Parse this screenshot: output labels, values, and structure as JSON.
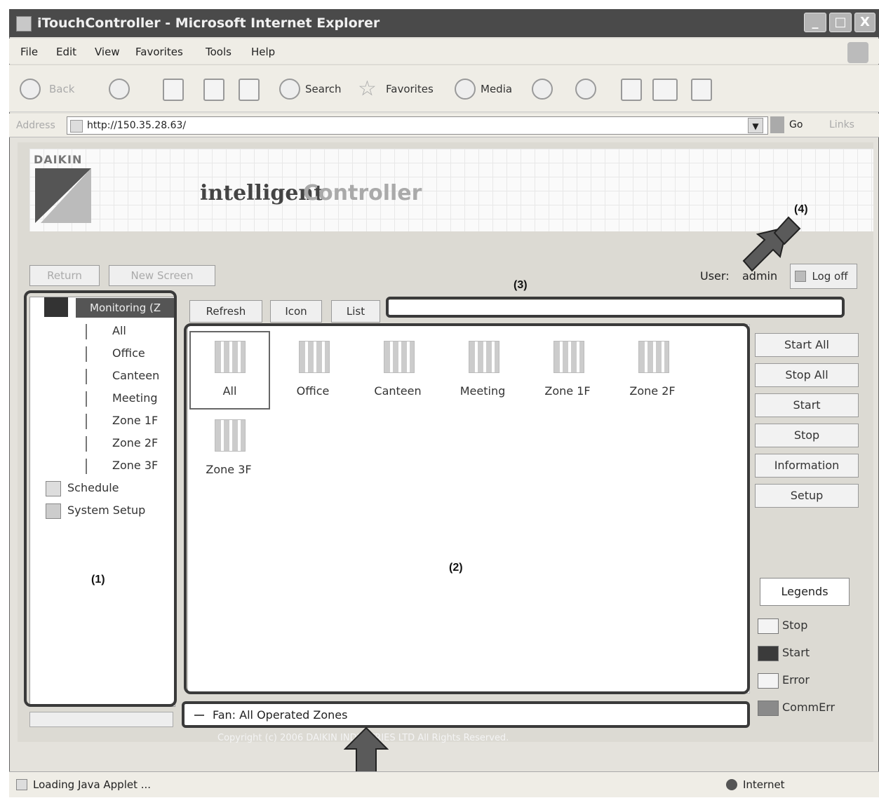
{
  "window": {
    "title": "iTouchController - Microsoft Internet Explorer",
    "min": "_",
    "max": "□",
    "close": "X"
  },
  "menu": [
    "File",
    "Edit",
    "View",
    "Favorites",
    "Tools",
    "Help"
  ],
  "toolbar": {
    "back": "Back",
    "search": "Search",
    "favorites": "Favorites",
    "media": "Media"
  },
  "address": {
    "label": "Address",
    "url": "http://150.35.28.63/",
    "go": "Go",
    "links": "Links"
  },
  "brand": {
    "logo_word": "DAIKIN",
    "part1": "intelligent",
    "part2": "Controller"
  },
  "nav": {
    "return_label": "Return",
    "new_screen_label": "New Screen",
    "user_label": "User:",
    "user_name": "admin",
    "logoff_label": "Log off"
  },
  "view_tabs": {
    "refresh": "Refresh",
    "icon": "Icon",
    "list": "List"
  },
  "tree": {
    "root": "Monitoring (Z",
    "zones": [
      "All",
      "Office",
      "Canteen",
      "Meeting",
      "Zone 1F",
      "Zone 2F",
      "Zone 3F"
    ],
    "schedule": "Schedule",
    "system_setup": "System Setup"
  },
  "zones": [
    "All",
    "Office",
    "Canteen",
    "Meeting",
    "Zone 1F",
    "Zone 2F",
    "Zone 3F"
  ],
  "status_strip": "Fan: All Operated Zones",
  "side_buttons": [
    "Start All",
    "Stop All",
    "Start",
    "Stop",
    "Information",
    "Setup"
  ],
  "legends": {
    "title": "Legends",
    "items": [
      {
        "label": "Stop",
        "color": "#f4f4f4"
      },
      {
        "label": "Start",
        "color": "#3b3b3b"
      },
      {
        "label": "Error",
        "color": "#f4f4f4"
      },
      {
        "label": "CommErr",
        "color": "#8a8a8a"
      }
    ]
  },
  "copyright": "Copyright (c) 2006 DAIKIN INDUSTRIES LTD All Rights Reserved.",
  "callouts": {
    "c1": "(1)",
    "c2": "(2)",
    "c3": "(3)",
    "c4": "(4)"
  },
  "ie_status": {
    "loading": "Loading Java Applet ...",
    "zone": "Internet"
  }
}
